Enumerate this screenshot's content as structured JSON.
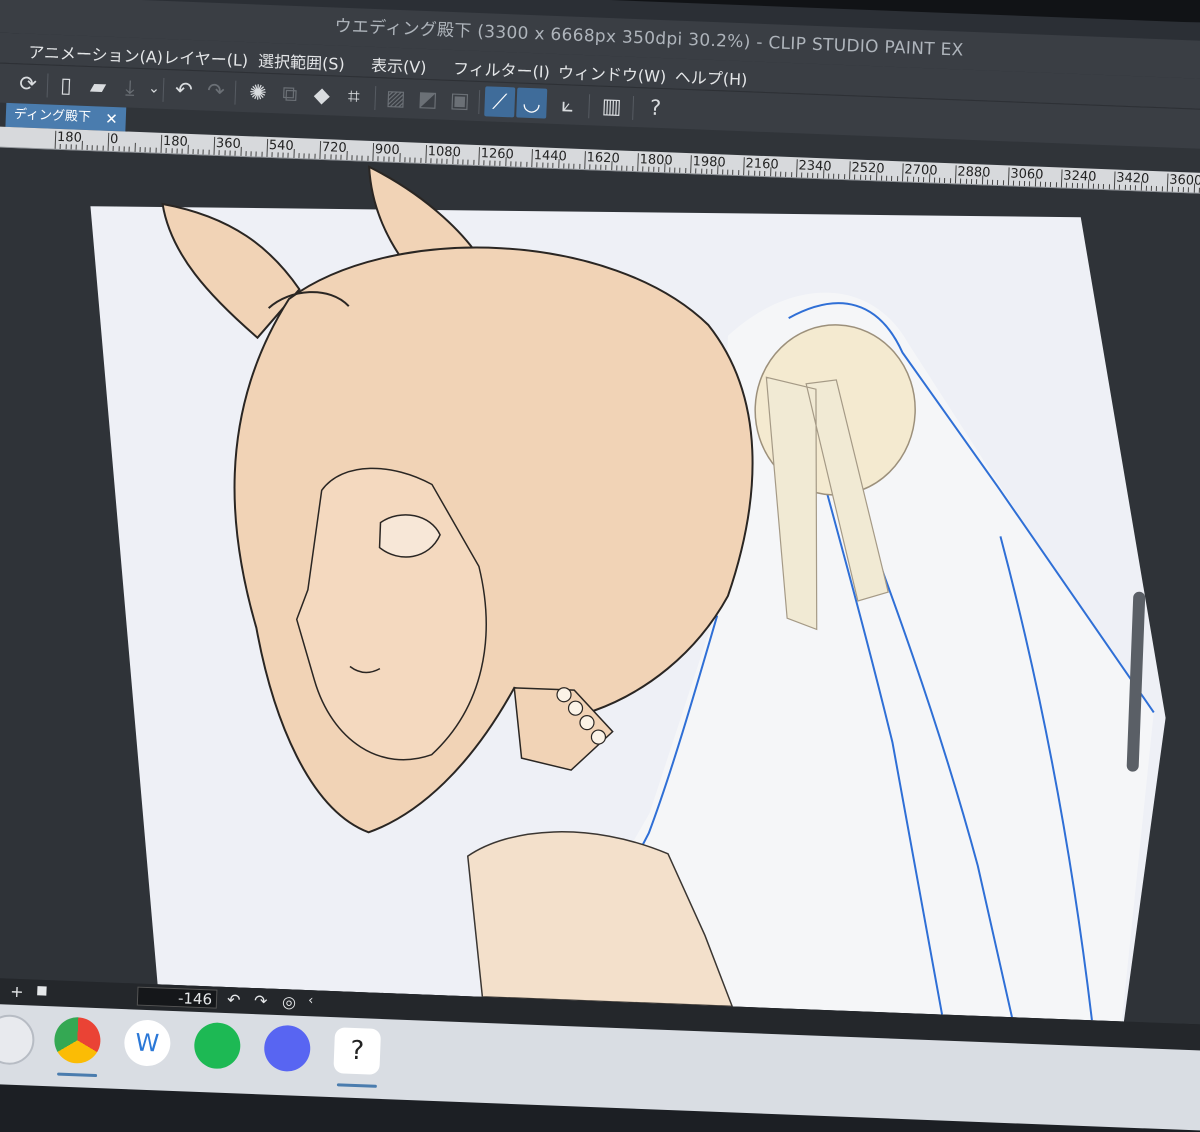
{
  "window": {
    "title": "ウエディング殿下 (3300 x 6668px 350dpi 30.2%) - CLIP STUDIO PAINT EX"
  },
  "menu": [
    "アニメーション(A)",
    "レイヤー(L)",
    "選択範囲(S)",
    "表示(V)",
    "フィルター(I)",
    "ウィンドウ(W)",
    "ヘルプ(H)"
  ],
  "tab": {
    "label": "ディング殿下",
    "close": "✕"
  },
  "ruler": {
    "labels": [
      "180",
      "0",
      "180",
      "360",
      "540",
      "720",
      "900",
      "1080",
      "1260",
      "1440",
      "1620",
      "1800",
      "1980",
      "2160",
      "2340",
      "2520",
      "2700",
      "2880",
      "3060",
      "3240",
      "3420",
      "3600"
    ]
  },
  "status": {
    "minus": "−",
    "plus": "+",
    "rotation": "-146"
  },
  "taskbar": {
    "apps": [
      "clip-studio-icon",
      "chrome-icon",
      "word-icon",
      "spotify-icon",
      "discord-icon",
      "clip-studio-paint-icon"
    ]
  },
  "colors": {
    "accent": "#4a7cae",
    "skin": "#f1d3b6",
    "veil_line": "#2f6fd6",
    "paper": "#eef0f6"
  }
}
